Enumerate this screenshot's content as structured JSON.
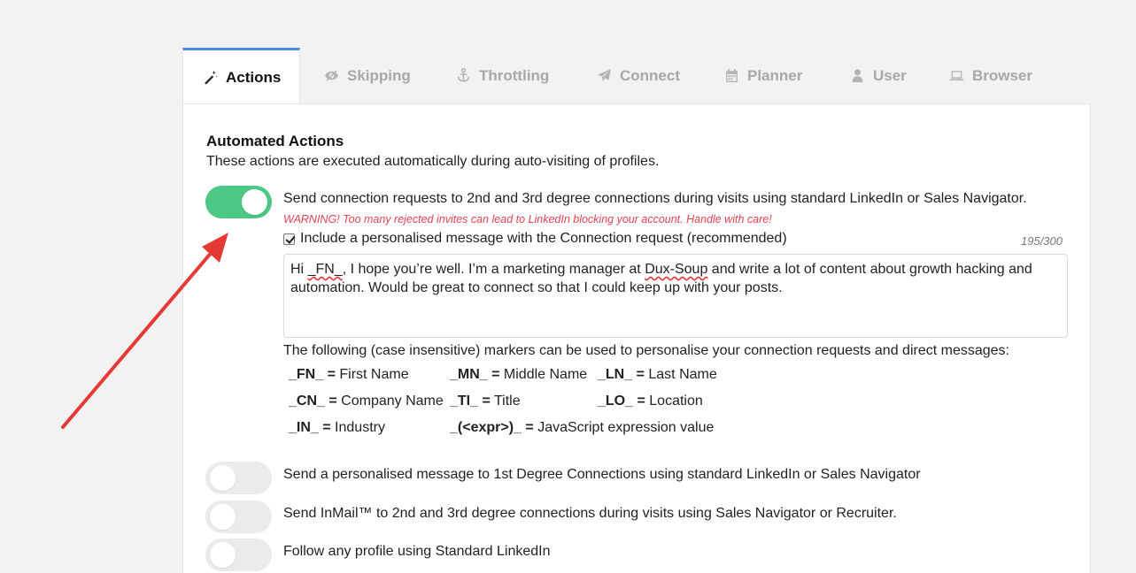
{
  "tabs": [
    {
      "label": "Actions",
      "icon": "magic-wand-icon",
      "active": true
    },
    {
      "label": "Skipping",
      "icon": "eye-slash-icon",
      "active": false
    },
    {
      "label": "Throttling",
      "icon": "anchor-icon",
      "active": false
    },
    {
      "label": "Connect",
      "icon": "paper-plane-icon",
      "active": false
    },
    {
      "label": "Planner",
      "icon": "calendar-icon",
      "active": false
    },
    {
      "label": "User",
      "icon": "user-icon",
      "active": false
    },
    {
      "label": "Browser",
      "icon": "laptop-icon",
      "active": false
    }
  ],
  "section": {
    "title": "Automated Actions",
    "subtitle": "These actions are executed automatically during auto-visiting of profiles."
  },
  "connect_action": {
    "label": "Send connection requests to 2nd and 3rd degree connections during visits using standard LinkedIn or Sales Navigator.",
    "enabled": true,
    "warning": "WARNING! Too many rejected invites can lead to LinkedIn blocking your account. Handle with care!",
    "include_message_label": "Include a personalised message with the Connection request (recommended)",
    "include_message_checked": true,
    "counter": "195/300",
    "message_part1": "Hi ",
    "message_marker": "_FN_",
    "message_part2": ", I hope you’re well. I’m a marketing manager at ",
    "message_company": "Dux-Soup",
    "message_part3": " and write a lot of content about growth hacking and automation. Would be great to connect so that I could keep up with your posts."
  },
  "markers": {
    "intro": "The following (case insensitive) markers can be used to personalise your connection requests and direct messages:",
    "items": [
      {
        "code": "_FN_ =",
        "desc": "First Name"
      },
      {
        "code": "_MN_ =",
        "desc": "Middle Name"
      },
      {
        "code": "_LN_ =",
        "desc": "Last Name"
      },
      {
        "code": "_CN_ =",
        "desc": "Company Name"
      },
      {
        "code": "_TI_ =",
        "desc": "Title"
      },
      {
        "code": "_LO_ =",
        "desc": "Location"
      },
      {
        "code": "_IN_ =",
        "desc": "Industry"
      },
      {
        "code": "_(<expr>)_ =",
        "desc": "JavaScript expression value"
      }
    ]
  },
  "other_actions": [
    {
      "label": "Send a personalised message to 1st Degree Connections using standard LinkedIn or Sales Navigator",
      "enabled": false
    },
    {
      "label": "Send InMail™ to 2nd and 3rd degree connections during visits using Sales Navigator or Recruiter.",
      "enabled": false
    },
    {
      "label": "Follow any profile using Standard LinkedIn",
      "enabled": false
    }
  ],
  "colors": {
    "accent_tab": "#4a8fe7",
    "toggle_on": "#4cc784",
    "warning": "#e8434f",
    "arrow": "#e53935"
  }
}
